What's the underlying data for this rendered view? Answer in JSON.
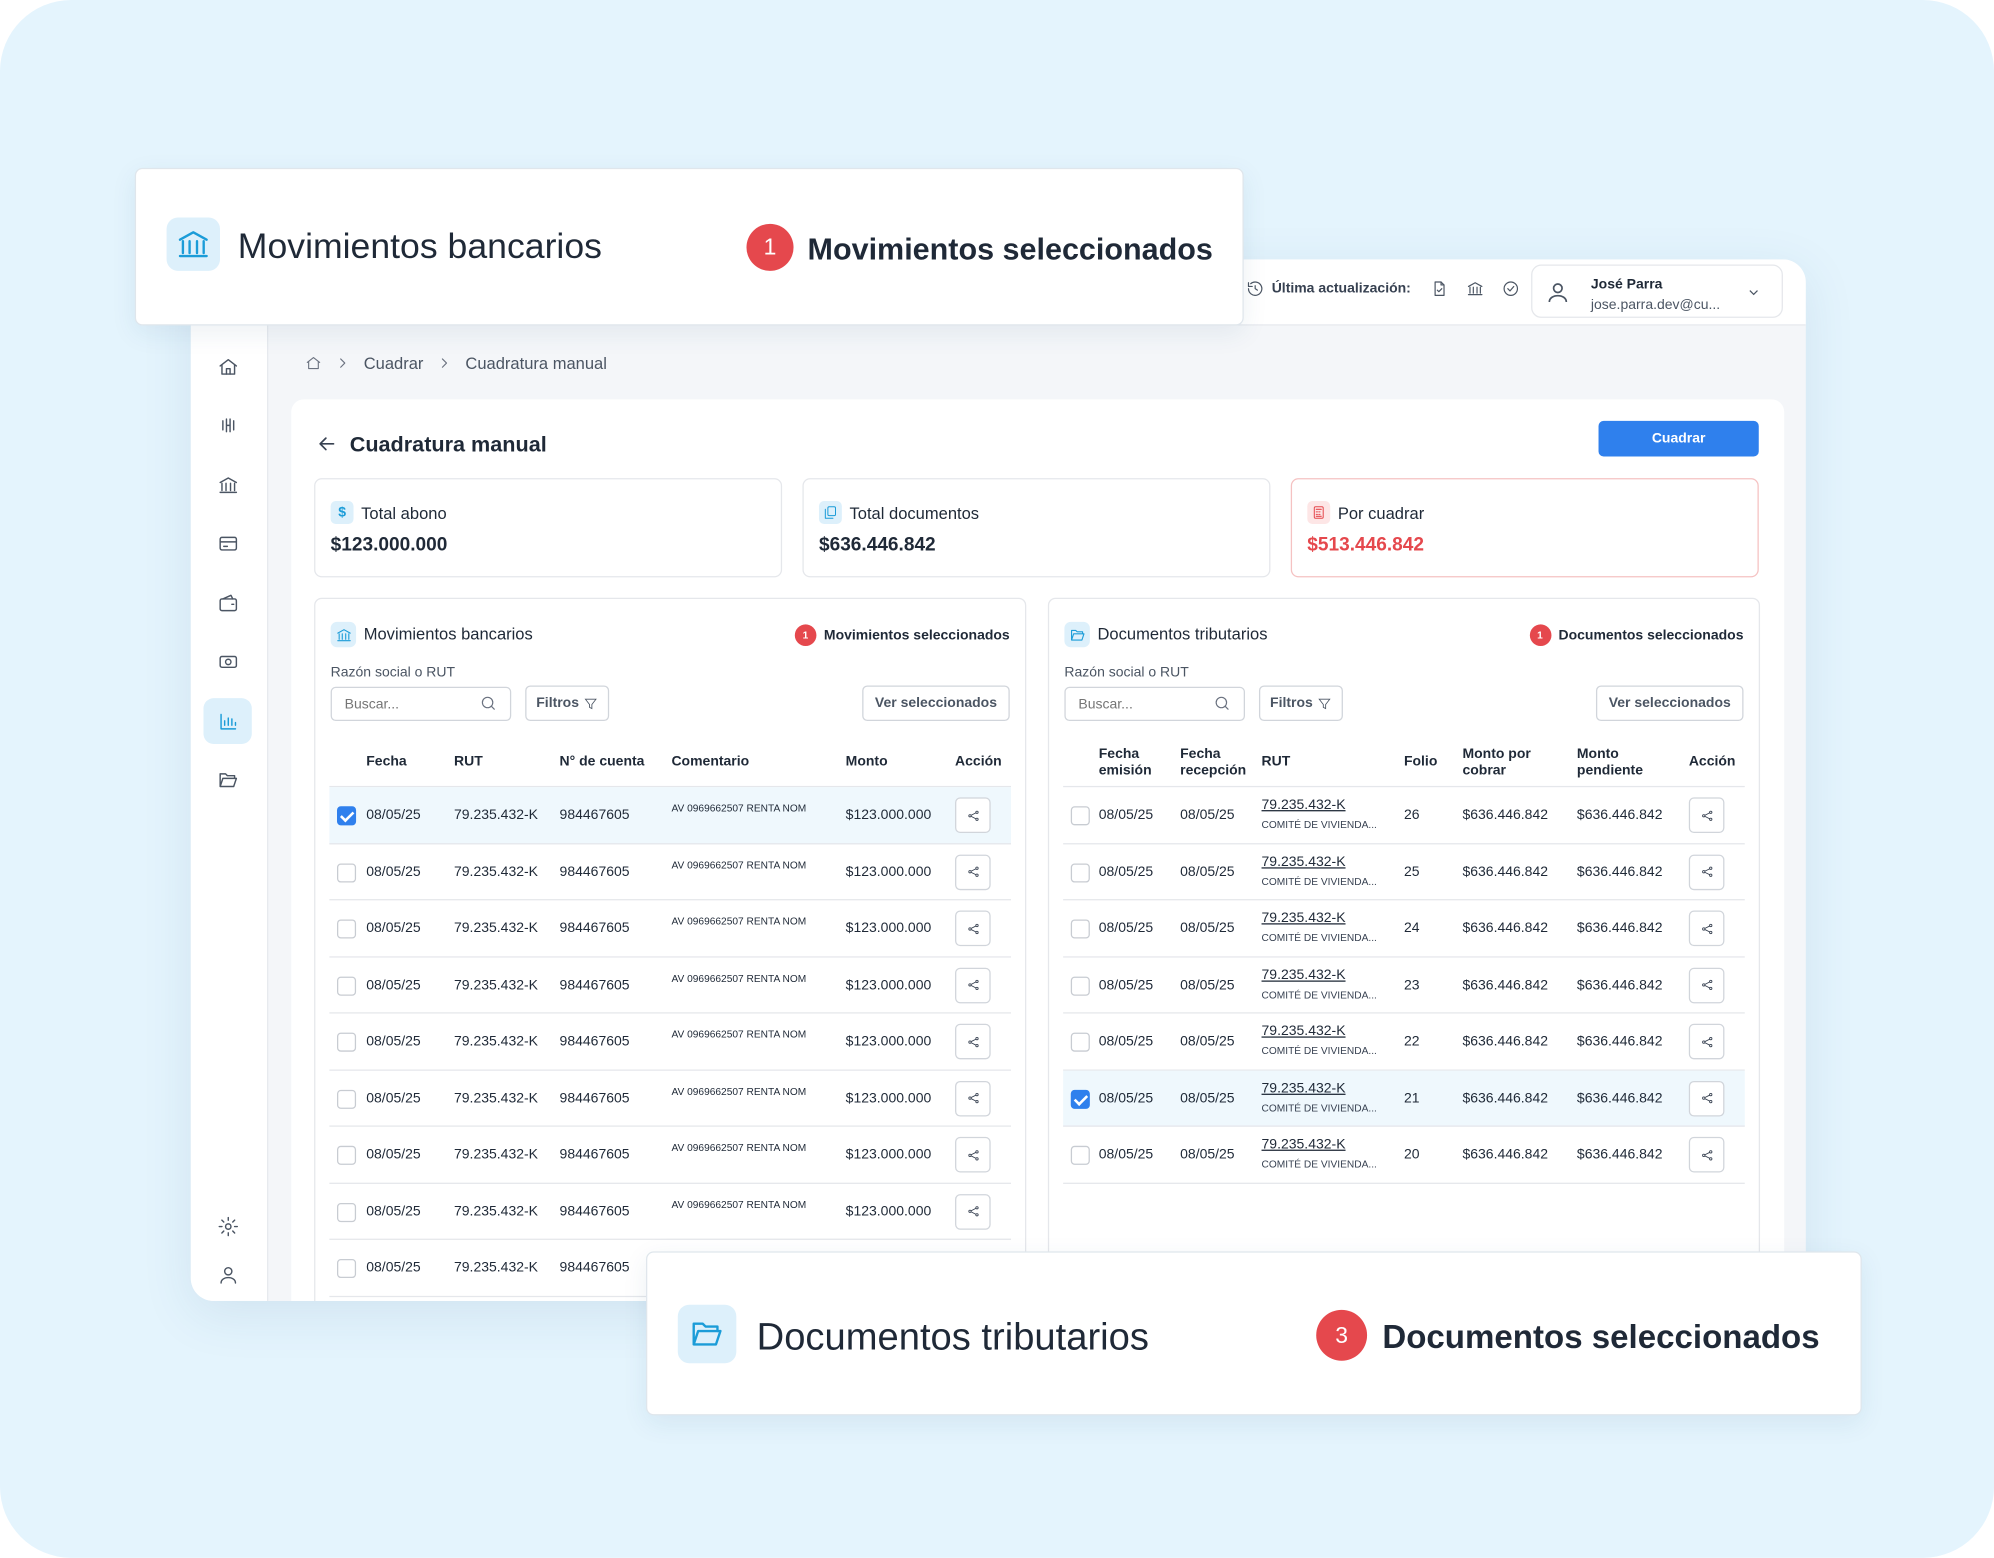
{
  "topbar": {
    "last_update_label": "Última actualización:",
    "user_name": "José Parra",
    "user_email": "jose.parra.dev@cu..."
  },
  "breadcrumb": [
    "Cuadrar",
    "Cuadratura manual"
  ],
  "page": {
    "title": "Cuadratura manual",
    "cuadrar_button": "Cuadrar"
  },
  "stats": [
    {
      "label": "Total abono",
      "value": "$123.000.000",
      "icon": "dollar-icon"
    },
    {
      "label": "Total documentos",
      "value": "$636.446.842",
      "icon": "documents-icon"
    },
    {
      "label": "Por cuadrar",
      "value": "$513.446.842",
      "icon": "calculator-icon",
      "color": "#e5484d"
    }
  ],
  "bank_panel": {
    "title": "Movimientos bancarios",
    "selected_count": "1",
    "selected_label": "Movimientos seleccionados",
    "filter_label": "Razón social o RUT",
    "search_placeholder": "Buscar...",
    "filters_button": "Filtros",
    "view_selected_button": "Ver seleccionados",
    "columns": [
      "Fecha",
      "RUT",
      "N° de cuenta",
      "Comentario",
      "Monto",
      "Acción"
    ],
    "rows": [
      {
        "checked": true,
        "fecha": "08/05/25",
        "rut": "79.235.432-K",
        "cuenta": "984467605",
        "comentario": "AV 0969662507 RENTA NOM",
        "monto": "$123.000.000"
      },
      {
        "checked": false,
        "fecha": "08/05/25",
        "rut": "79.235.432-K",
        "cuenta": "984467605",
        "comentario": "AV 0969662507 RENTA NOM",
        "monto": "$123.000.000"
      },
      {
        "checked": false,
        "fecha": "08/05/25",
        "rut": "79.235.432-K",
        "cuenta": "984467605",
        "comentario": "AV 0969662507 RENTA NOM",
        "monto": "$123.000.000"
      },
      {
        "checked": false,
        "fecha": "08/05/25",
        "rut": "79.235.432-K",
        "cuenta": "984467605",
        "comentario": "AV 0969662507 RENTA NOM",
        "monto": "$123.000.000"
      },
      {
        "checked": false,
        "fecha": "08/05/25",
        "rut": "79.235.432-K",
        "cuenta": "984467605",
        "comentario": "AV 0969662507 RENTA NOM",
        "monto": "$123.000.000"
      },
      {
        "checked": false,
        "fecha": "08/05/25",
        "rut": "79.235.432-K",
        "cuenta": "984467605",
        "comentario": "AV 0969662507 RENTA NOM",
        "monto": "$123.000.000"
      },
      {
        "checked": false,
        "fecha": "08/05/25",
        "rut": "79.235.432-K",
        "cuenta": "984467605",
        "comentario": "AV 0969662507 RENTA NOM",
        "monto": "$123.000.000"
      },
      {
        "checked": false,
        "fecha": "08/05/25",
        "rut": "79.235.432-K",
        "cuenta": "984467605",
        "comentario": "AV 0969662507 RENTA NOM",
        "monto": "$123.000.000"
      },
      {
        "checked": false,
        "fecha": "08/05/25",
        "rut": "79.235.432-K",
        "cuenta": "984467605",
        "comentario": "",
        "monto": ""
      }
    ]
  },
  "docs_panel": {
    "title": "Documentos tributarios",
    "selected_count": "1",
    "selected_label": "Documentos seleccionados",
    "filter_label": "Razón social o RUT",
    "search_placeholder": "Buscar...",
    "filters_button": "Filtros",
    "view_selected_button": "Ver seleccionados",
    "columns": [
      "Fecha emisión",
      "Fecha recepción",
      "RUT",
      "Folio",
      "Monto por cobrar",
      "Monto pendiente",
      "Acción"
    ],
    "rows": [
      {
        "checked": false,
        "emision": "08/05/25",
        "recepcion": "08/05/25",
        "rut": "79.235.432-K",
        "razon": "COMITÉ DE VIVIENDA...",
        "folio": "26",
        "por_cobrar": "$636.446.842",
        "pendiente": "$636.446.842"
      },
      {
        "checked": false,
        "emision": "08/05/25",
        "recepcion": "08/05/25",
        "rut": "79.235.432-K",
        "razon": "COMITÉ DE VIVIENDA...",
        "folio": "25",
        "por_cobrar": "$636.446.842",
        "pendiente": "$636.446.842"
      },
      {
        "checked": false,
        "emision": "08/05/25",
        "recepcion": "08/05/25",
        "rut": "79.235.432-K",
        "razon": "COMITÉ DE VIVIENDA...",
        "folio": "24",
        "por_cobrar": "$636.446.842",
        "pendiente": "$636.446.842"
      },
      {
        "checked": false,
        "emision": "08/05/25",
        "recepcion": "08/05/25",
        "rut": "79.235.432-K",
        "razon": "COMITÉ DE VIVIENDA...",
        "folio": "23",
        "por_cobrar": "$636.446.842",
        "pendiente": "$636.446.842"
      },
      {
        "checked": false,
        "emision": "08/05/25",
        "recepcion": "08/05/25",
        "rut": "79.235.432-K",
        "razon": "COMITÉ DE VIVIENDA...",
        "folio": "22",
        "por_cobrar": "$636.446.842",
        "pendiente": "$636.446.842"
      },
      {
        "checked": true,
        "emision": "08/05/25",
        "recepcion": "08/05/25",
        "rut": "79.235.432-K",
        "razon": "COMITÉ DE VIVIENDA...",
        "folio": "21",
        "por_cobrar": "$636.446.842",
        "pendiente": "$636.446.842"
      },
      {
        "checked": false,
        "emision": "08/05/25",
        "recepcion": "08/05/25",
        "rut": "79.235.432-K",
        "razon": "COMITÉ DE VIVIENDA...",
        "folio": "20",
        "por_cobrar": "$636.446.842",
        "pendiente": "$636.446.842"
      }
    ]
  },
  "callout_bank": {
    "title": "Movimientos bancarios",
    "count": "1",
    "label": "Movimientos seleccionados"
  },
  "callout_docs": {
    "title": "Documentos tributarios",
    "count": "3",
    "label": "Documentos seleccionados"
  },
  "colors": {
    "accent": "#1b9cd8",
    "primary_button": "#2f80ed",
    "danger": "#e5484d",
    "background": "#e4f4fd"
  }
}
